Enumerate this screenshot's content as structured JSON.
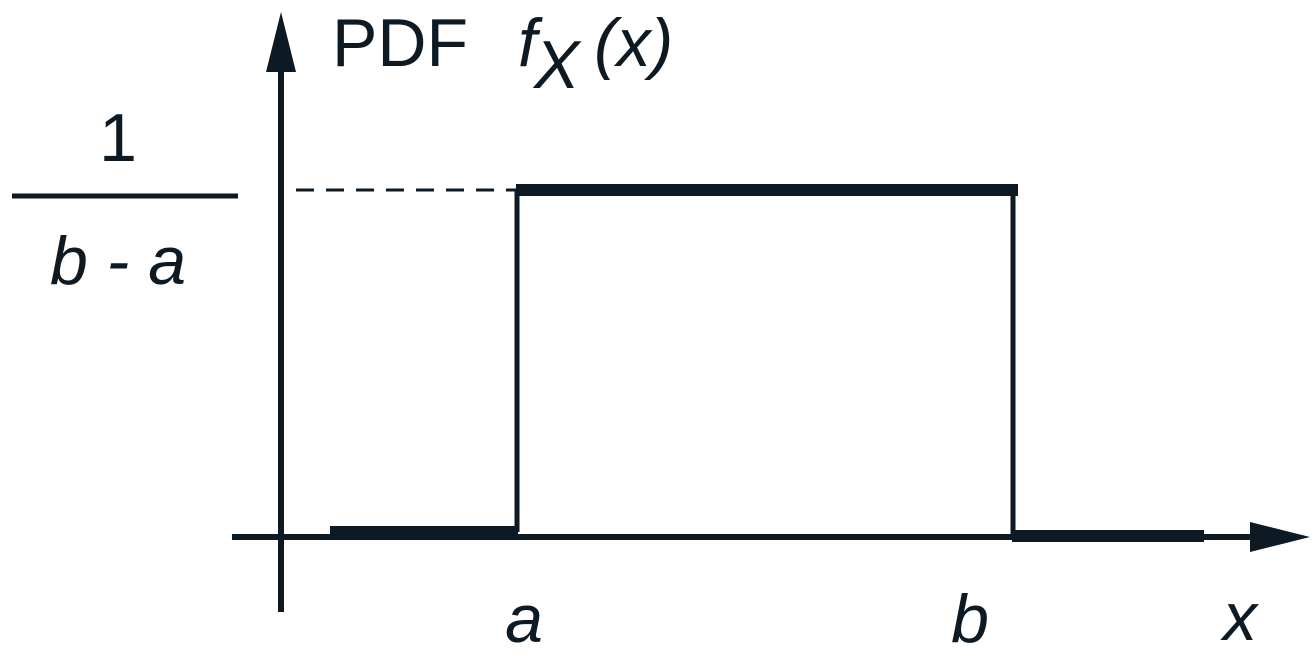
{
  "ylabel": {
    "prefix": "PDF",
    "func": "f",
    "subscript": "X",
    "arg": "(x)"
  },
  "height_label": {
    "numerator": "1",
    "denominator": "b - a"
  },
  "xticks": {
    "a": "a",
    "b": "b"
  },
  "xlabel": "x",
  "colors": {
    "ink": "#0d1a24",
    "background": "#ffffff"
  }
}
